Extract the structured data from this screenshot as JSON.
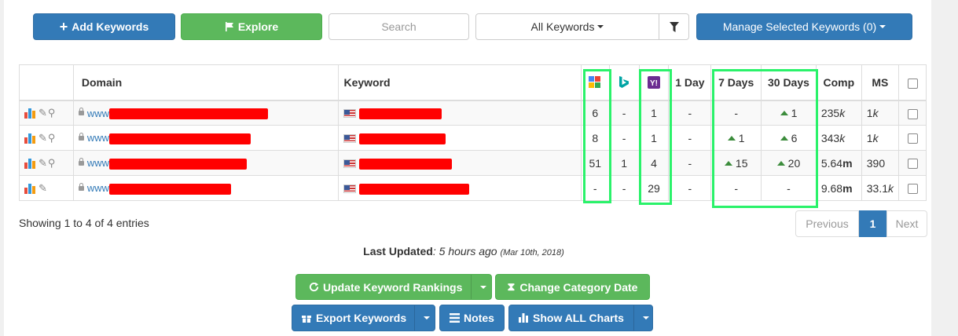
{
  "toolbar": {
    "add_keywords": "Add Keywords",
    "explore": "Explore",
    "search_placeholder": "Search",
    "filter_select": "All Keywords",
    "manage_selected": "Manage Selected Keywords (0)"
  },
  "table": {
    "headers": {
      "domain": "Domain",
      "keyword": "Keyword",
      "google_icon": "google-icon",
      "bing_icon": "bing-icon",
      "yahoo_icon": "yahoo-icon",
      "day1": "1 Day",
      "day7": "7 Days",
      "day30": "30 Days",
      "comp": "Comp",
      "ms": "MS"
    },
    "rows": [
      {
        "domain_prefix": "www",
        "google": "6",
        "bing": "-",
        "yahoo": "1",
        "day1": "-",
        "day7": "-",
        "day30": "1",
        "comp": "235",
        "comp_unit": "k",
        "ms": "1",
        "ms_unit": "k"
      },
      {
        "domain_prefix": "www",
        "google": "8",
        "bing": "-",
        "yahoo": "1",
        "day1": "-",
        "day7": "1",
        "day30": "6",
        "comp": "343",
        "comp_unit": "k",
        "ms": "1",
        "ms_unit": "k"
      },
      {
        "domain_prefix": "www",
        "google": "51",
        "bing": "1",
        "yahoo": "4",
        "day1": "-",
        "day7": "15",
        "day30": "20",
        "comp": "5.64",
        "comp_unit": "m",
        "ms": "390",
        "ms_unit": ""
      },
      {
        "domain_prefix": "www",
        "google": "-",
        "bing": "-",
        "yahoo": "29",
        "day1": "-",
        "day7": "-",
        "day30": "-",
        "comp": "9.68",
        "comp_unit": "m",
        "ms": "33.1",
        "ms_unit": "k"
      }
    ]
  },
  "footer": {
    "showing": "Showing 1 to 4 of 4 entries",
    "previous": "Previous",
    "page": "1",
    "next": "Next",
    "last_updated_label": "Last Updated",
    "last_updated_value": ": 5 hours ago",
    "last_updated_date": "(Mar 10th, 2018)"
  },
  "actions": {
    "update_rankings": "Update Keyword Rankings",
    "change_category_date": "Change Category Date",
    "export_keywords": "Export Keywords",
    "notes": "Notes",
    "show_all_charts": "Show ALL Charts"
  },
  "colors": {
    "primary": "#337ab7",
    "success": "#5cb85c",
    "highlight": "#2af26a",
    "redaction": "#ff0000"
  }
}
